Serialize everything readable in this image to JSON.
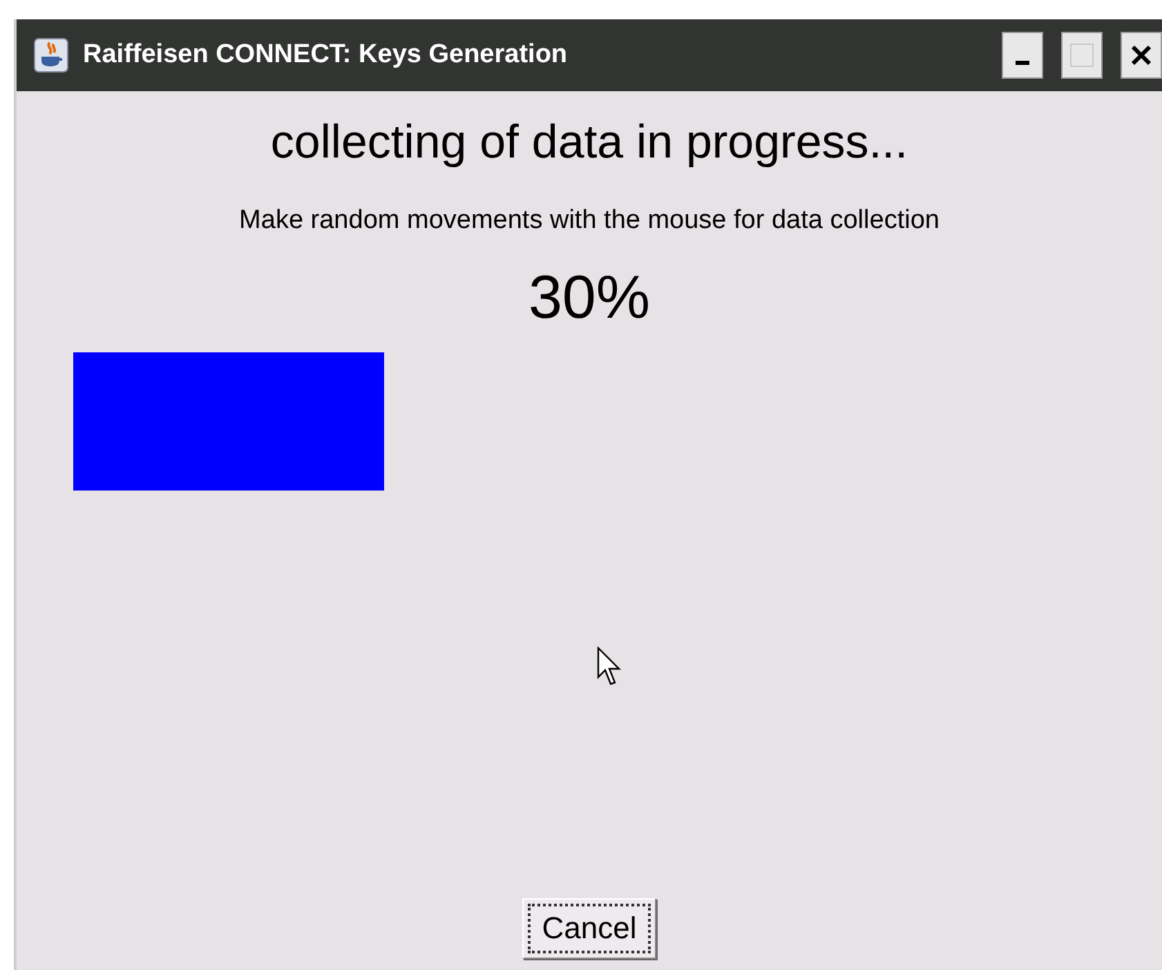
{
  "window": {
    "title": "Raiffeisen CONNECT: Keys Generation",
    "controls": [
      {
        "kind": "minimize",
        "disabled": false
      },
      {
        "kind": "maximize",
        "disabled": true
      },
      {
        "kind": "close",
        "disabled": false
      }
    ]
  },
  "heading": "collecting of data in progress...",
  "instruction": "Make random movements with the mouse for data collection",
  "progress": {
    "reading": "30%",
    "level": 0.3
  },
  "buttons": [
    {
      "label": "Cancel",
      "focused": true
    }
  ]
}
